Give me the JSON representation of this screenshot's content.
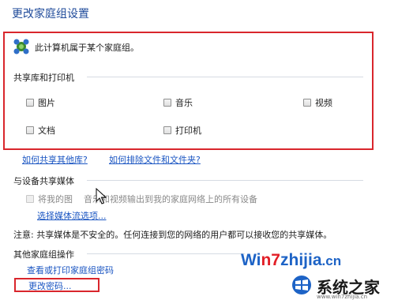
{
  "page": {
    "title": "更改家庭组设置"
  },
  "homegroup": {
    "info_text": "此计算机属于某个家庭组。",
    "share_section_label": "共享库和打印机",
    "libraries": [
      {
        "label": "图片",
        "checked": false
      },
      {
        "label": "音乐",
        "checked": false
      },
      {
        "label": "视频",
        "checked": false
      },
      {
        "label": "文档",
        "checked": false
      },
      {
        "label": "打印机",
        "checked": false
      }
    ],
    "link_share_other": "如何共享其他库?",
    "link_exclude": "如何排除文件和文件夹?"
  },
  "media": {
    "section_label": "与设备共享媒体",
    "stream_prefix": "将我的图",
    "stream_text": "音乐和视频输出到我的家庭网络上的所有设备",
    "stream_checked": false,
    "options_link": "选择媒体流选项...",
    "note": "注意: 共享媒体是不安全的。任何连接到您的网络的用户都可以接收您的共享媒体。"
  },
  "other_actions": {
    "section_label": "其他家庭组操作",
    "view_print_password": "查看或打印家庭组密码",
    "change_password": "更改密码..."
  },
  "watermark": {
    "site_prefix": "Wi",
    "site_highlight": "n7",
    "site_rest": "zhijia",
    "site_tld": ".cn",
    "brand": "系统之家",
    "url": "www.win7zhijia.cn"
  },
  "colors": {
    "title": "#1e4a9a",
    "link": "#1a55c2",
    "highlight_box": "#d9262c",
    "watermark_blue": "#1d63c6",
    "watermark_red": "#e21e26"
  }
}
